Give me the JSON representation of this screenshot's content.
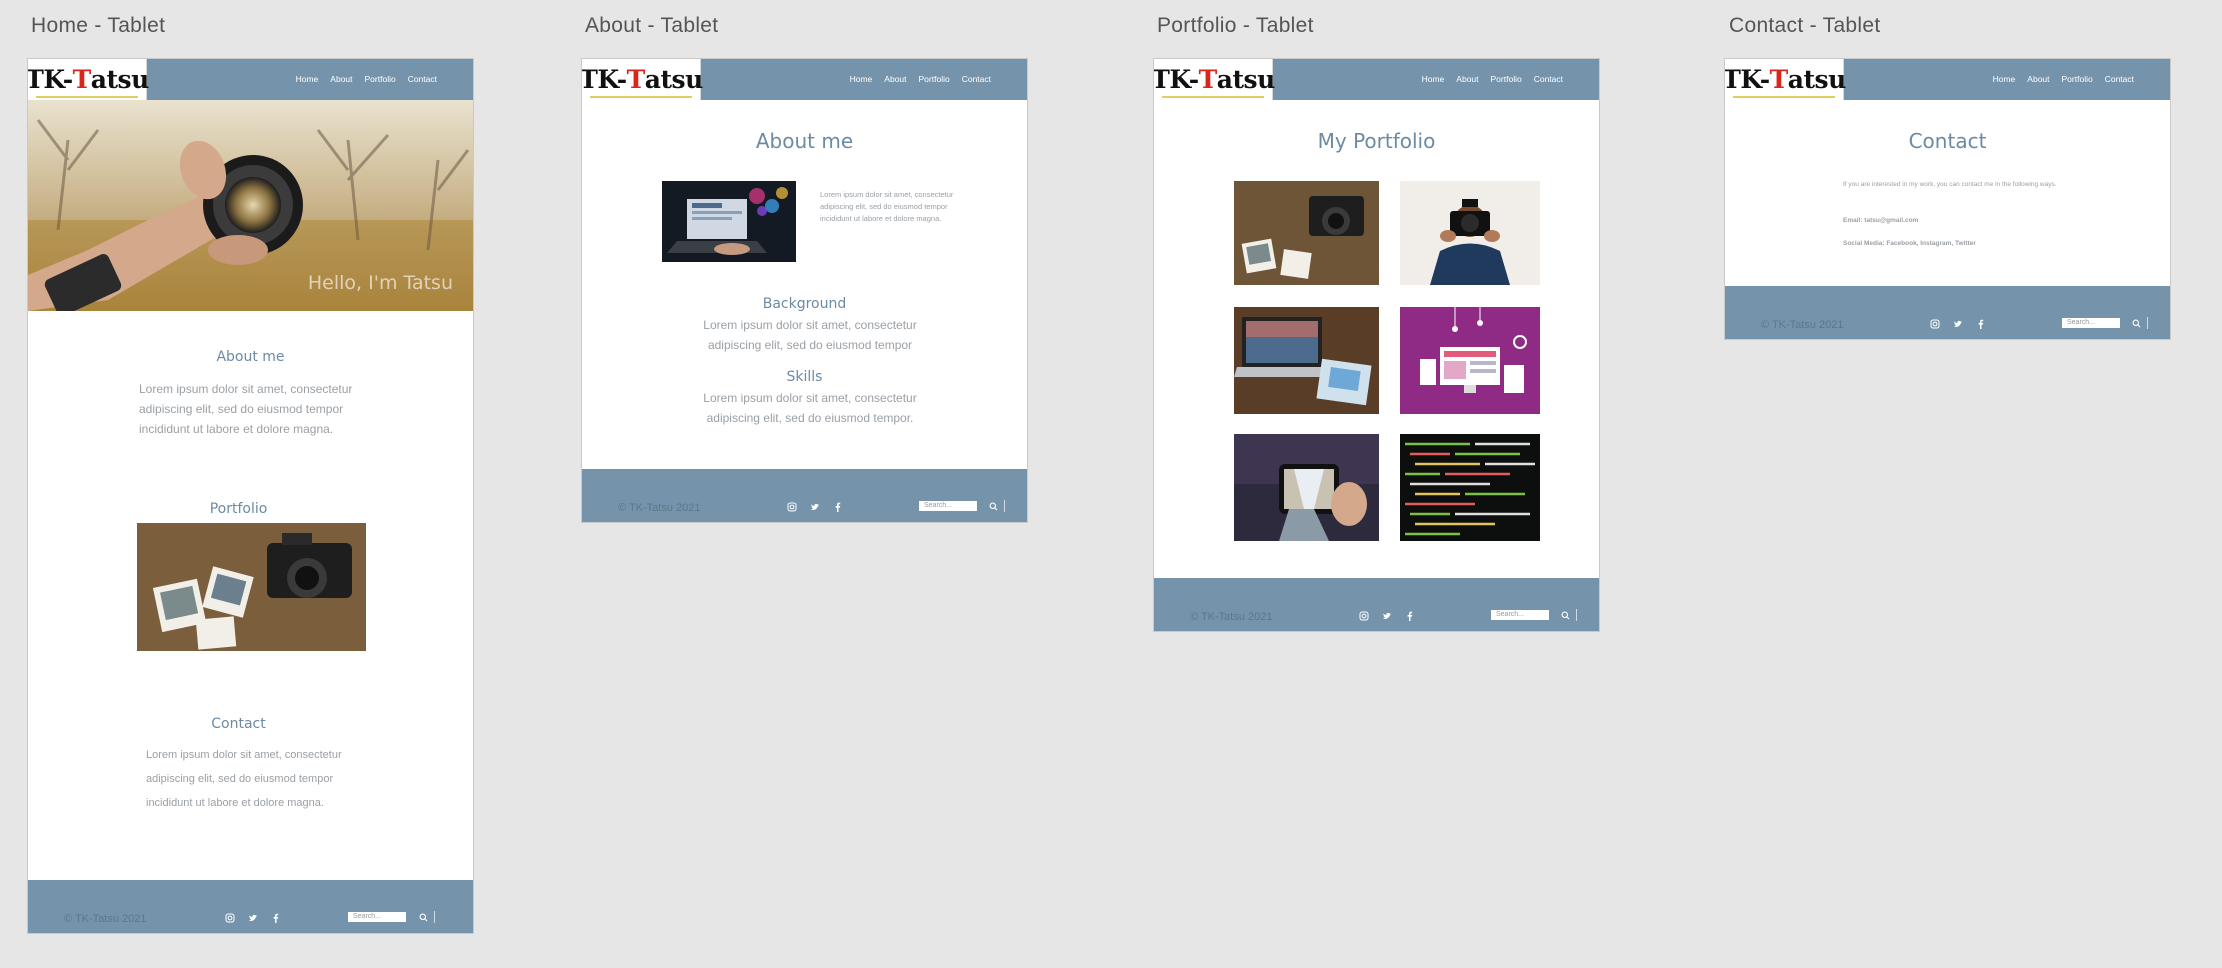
{
  "artboards": {
    "home": "Home - Tablet",
    "about": "About - Tablet",
    "portfolio": "Portfolio - Tablet",
    "contact": "Contact - Tablet"
  },
  "brand": {
    "logo_part1": "TK-",
    "logo_part2": "T",
    "logo_part3": "atsu",
    "accent_color": "#7594ab",
    "logo_red": "#d8261c"
  },
  "nav": {
    "home": "Home",
    "about": "About",
    "portfolio": "Portfolio",
    "contact": "Contact"
  },
  "footer": {
    "copyright": "© TK-Tatsu 2021",
    "search_placeholder": "Search...",
    "icons": [
      "instagram-icon",
      "twitter-icon",
      "facebook-icon",
      "search-icon"
    ]
  },
  "home": {
    "hero_text": "Hello, I'm Tatsu",
    "about_heading": "About me",
    "about_text": "Lorem ipsum dolor sit amet, consectetur adipiscing elit, sed do eiusmod tempor incididunt ut labore et dolore magna.",
    "portfolio_heading": "Portfolio",
    "contact_heading": "Contact",
    "contact_text": "Lorem ipsum dolor sit amet, consectetur adipiscing elit, sed do eiusmod tempor incididunt ut labore et dolore magna."
  },
  "about": {
    "heading": "About me",
    "intro_text": "Lorem ipsum dolor sit amet, consectetur adipiscing elit, sed do eiusmod tempor incididunt ut labore et dolore magna.",
    "background_heading": "Background",
    "background_text": "Lorem ipsum dolor sit amet, consectetur adipiscing elit, sed do eiusmod tempor",
    "skills_heading": "Skills",
    "skills_text": "Lorem ipsum dolor sit amet, consectetur adipiscing elit, sed do eiusmod tempor."
  },
  "portfolio": {
    "heading": "My Portfolio"
  },
  "contact": {
    "heading": "Contact",
    "intro_text": "If you are interested in my work, you can contact me in the following ways.",
    "email": "Email: tatsu@gmail.com",
    "social": "Social Media: Facebook, Instagram, Twitter"
  }
}
